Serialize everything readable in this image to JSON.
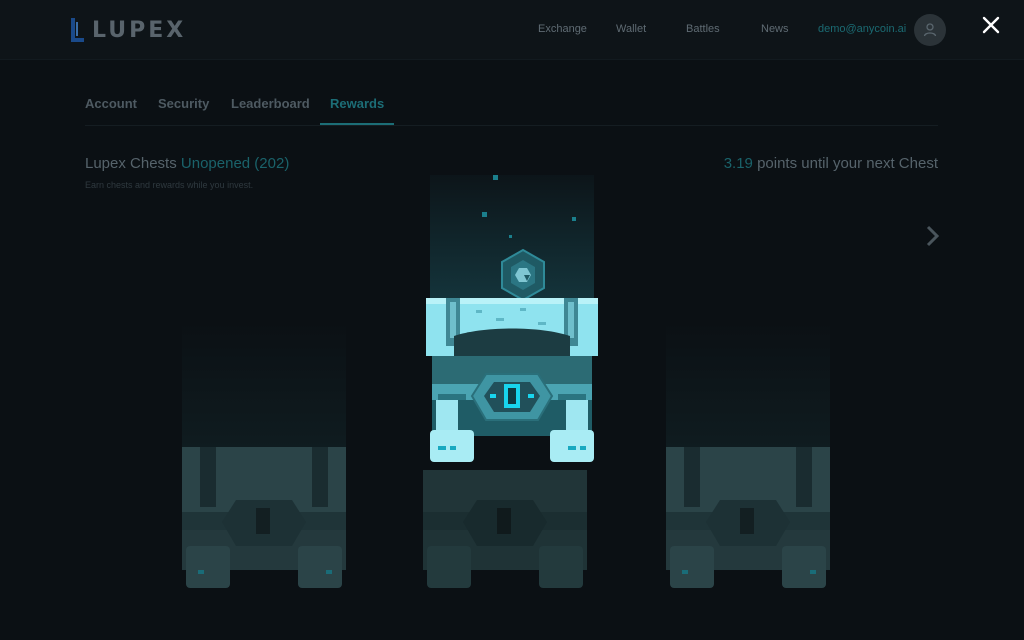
{
  "brand": {
    "name": "LUPEX"
  },
  "nav": {
    "items": [
      "Exchange",
      "Wallet",
      "Battles",
      "News"
    ],
    "email": "demo@anycoin.ai"
  },
  "tabs": [
    {
      "label": "Account",
      "active": false
    },
    {
      "label": "Security",
      "active": false
    },
    {
      "label": "Leaderboard",
      "active": false
    },
    {
      "label": "Rewards",
      "active": true
    }
  ],
  "rewards": {
    "title": "Lupex Chests",
    "unopened": "Unopened (202)",
    "subtitle": "Earn chests and rewards while you invest.",
    "points_value": "3.19",
    "points_text": "points until your next Chest"
  },
  "icons": {
    "close": "close-icon",
    "avatar": "user-icon",
    "next": "chevron-right-icon",
    "coin": "hexagon-coin-icon"
  },
  "colors": {
    "background": "#0b1014",
    "accent": "#1c6d76",
    "chest_glow": "#7fdfee",
    "chest_dim": "#2c4a4e"
  }
}
